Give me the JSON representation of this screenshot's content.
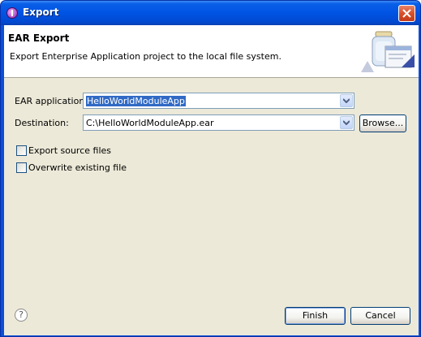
{
  "window": {
    "title": "Export"
  },
  "banner": {
    "title": "EAR Export",
    "description": "Export Enterprise Application project to the local file system."
  },
  "form": {
    "ear_application": {
      "label": "EAR application:",
      "value": "HelloWorldModuleApp"
    },
    "destination": {
      "label": "Destination:",
      "value": "C:\\HelloWorldModuleApp.ear",
      "browse_label": "Browse..."
    },
    "export_source_files": {
      "label": "Export source files",
      "checked": false
    },
    "overwrite_existing_file": {
      "label": "Overwrite existing file",
      "checked": false
    }
  },
  "footer": {
    "help_icon": "question-mark",
    "finish_label": "Finish",
    "cancel_label": "Cancel"
  },
  "colors": {
    "titlebar": "#0054e3",
    "dialog_background": "#ece9d8",
    "selection": "#316ac5"
  }
}
